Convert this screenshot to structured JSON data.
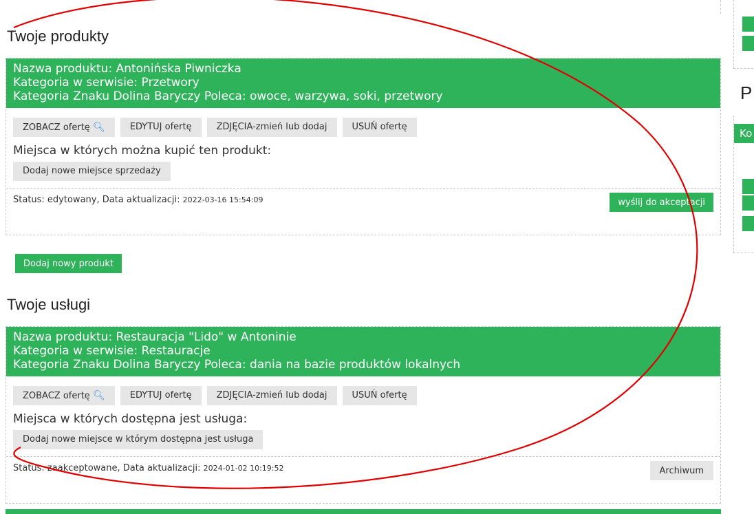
{
  "products_section": {
    "title": "Twoje produkty",
    "card": {
      "line1": "Nazwa produktu: Antonińska Piwniczka",
      "line2": "Kategoria w serwisie: Przetwory",
      "line3": "Kategoria Znaku Dolina Baryczy Poleca: owoce, warzywa, soki, przetwory",
      "view_button": "ZOBACZ ofertę",
      "edit_button": "EDYTUJ ofertę",
      "photos_button": "ZDJĘCIA-zmień lub dodaj",
      "delete_button": "USUŃ ofertę",
      "places_title": "Miejsca w których można kupić ten produkt:",
      "add_place_button": "Dodaj nowe miejsce sprzedaży",
      "status_label": "Status: edytowany,  Data aktualizacji:",
      "status_time": "2022-03-16 15:54:09",
      "send_button": "wyślij do akceptacji"
    },
    "add_button": "Dodaj nowy produkt"
  },
  "services_section": {
    "title": "Twoje usługi",
    "card": {
      "line1": "Nazwa produktu: Restauracja \"Lido\" w Antoninie",
      "line2": "Kategoria w serwisie: Restauracje",
      "line3": "Kategoria Znaku Dolina Baryczy Poleca: dania na bazie produktów lokalnych",
      "view_button": "ZOBACZ ofertę",
      "edit_button": "EDYTUJ ofertę",
      "photos_button": "ZDJĘCIA-zmień lub dodaj",
      "delete_button": "USUŃ ofertę",
      "places_title": "Miejsca w których dostępna jest usługa:",
      "add_place_button": "Dodaj nowe miejsce w którym dostępna jest usługa",
      "status_label": "Status: zaakceptowane,  Data aktualizacji:",
      "status_time": "2024-01-02 10:19:52",
      "archive_button": "Archiwum"
    }
  },
  "sidebar": {
    "title": "P",
    "head": "Ko"
  },
  "colors": {
    "accent_green": "#2eb25a",
    "button_grey": "#e6e6e6",
    "annotation_red": "#e00000"
  },
  "icons": {
    "view": "magnifier-icon"
  }
}
